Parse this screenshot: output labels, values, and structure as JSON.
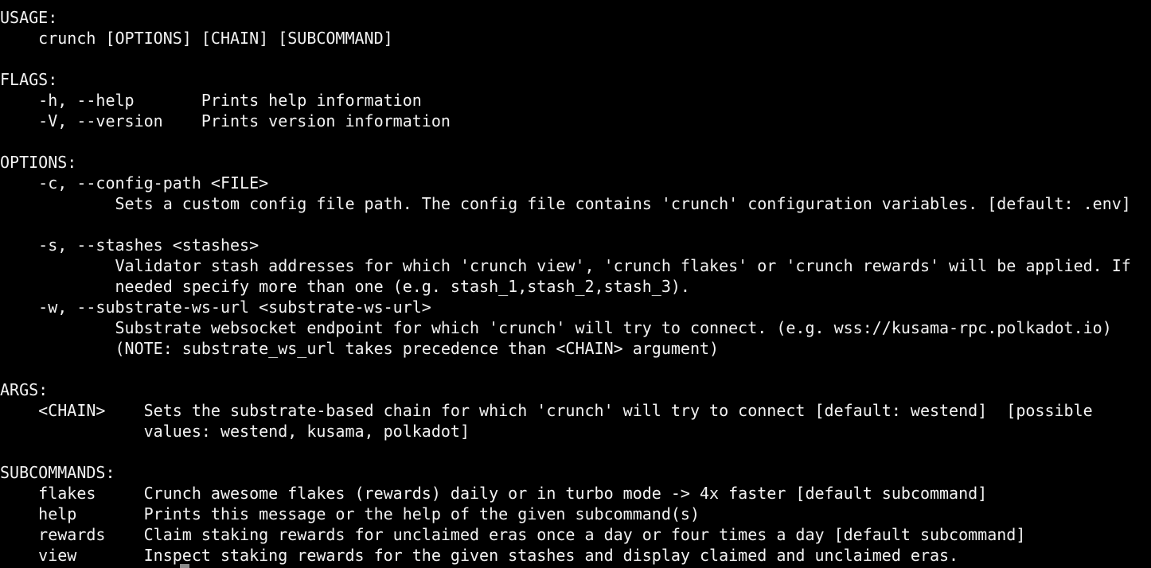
{
  "terminal": {
    "lines": [
      "USAGE:",
      "    crunch [OPTIONS] [CHAIN] [SUBCOMMAND]",
      "",
      "FLAGS:",
      "    -h, --help       Prints help information",
      "    -V, --version    Prints version information",
      "",
      "OPTIONS:",
      "    -c, --config-path <FILE>",
      "            Sets a custom config file path. The config file contains 'crunch' configuration variables. [default: .env]",
      "",
      "    -s, --stashes <stashes>",
      "            Validator stash addresses for which 'crunch view', 'crunch flakes' or 'crunch rewards' will be applied. If",
      "            needed specify more than one (e.g. stash_1,stash_2,stash_3).",
      "    -w, --substrate-ws-url <substrate-ws-url>",
      "            Substrate websocket endpoint for which 'crunch' will try to connect. (e.g. wss://kusama-rpc.polkadot.io)",
      "            (NOTE: substrate_ws_url takes precedence than <CHAIN> argument)",
      "",
      "ARGS:",
      "    <CHAIN>    Sets the substrate-based chain for which 'crunch' will try to connect [default: westend]  [possible",
      "               values: westend, kusama, polkadot]",
      "",
      "SUBCOMMANDS:",
      "    flakes     Crunch awesome flakes (rewards) daily or in turbo mode -> 4x faster [default subcommand]",
      "    help       Prints this message or the help of the given subcommand(s)",
      "    rewards    Claim staking rewards for unclaimed eras once a day or four times a day [default subcommand]",
      "    view       Inspect staking rewards for the given stashes and display claimed and unclaimed eras."
    ]
  }
}
